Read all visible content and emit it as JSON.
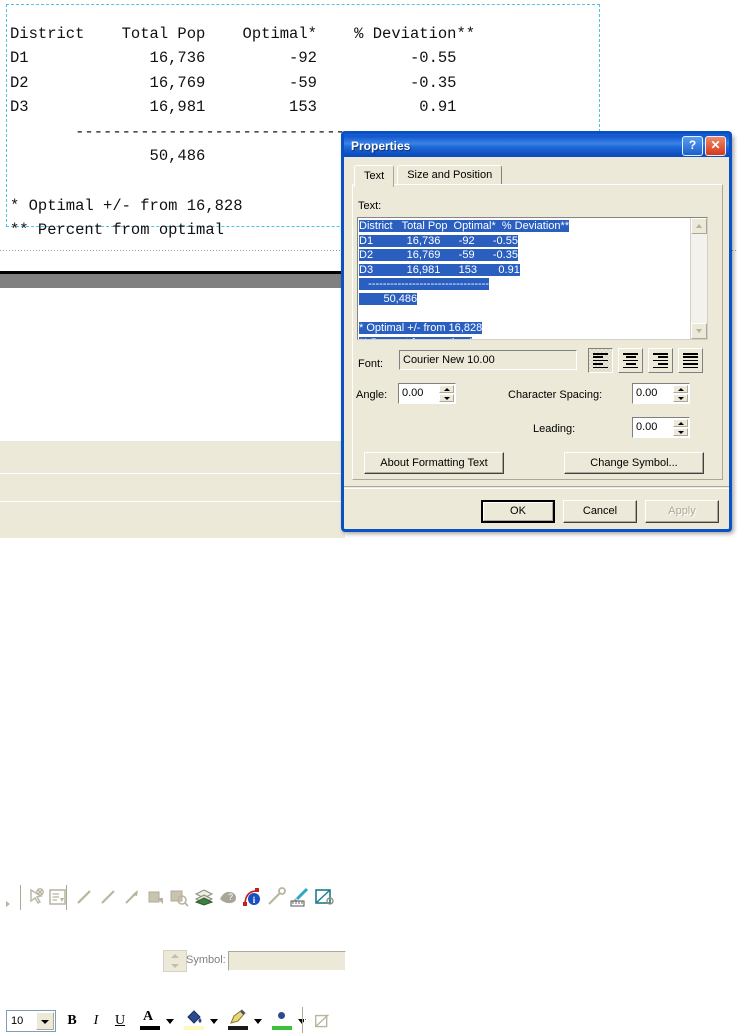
{
  "layout": {
    "report_text": "District    Total Pop    Optimal*    % Deviation**\nD1             16,736         -92          -0.55\nD2             16,769         -59          -0.35\nD3             16,981         153           0.91\n       ------------------------------------------\n               50,486\n\n* Optimal +/- from 16,828\n** Percent from optimal"
  },
  "report_table": {
    "columns": [
      "District",
      "Total Pop",
      "Optimal*",
      "% Deviation**"
    ],
    "rows": [
      [
        "D1",
        "16,736",
        "-92",
        "-0.55"
      ],
      [
        "D2",
        "16,769",
        "-59",
        "-0.35"
      ],
      [
        "D3",
        "16,981",
        "153",
        "0.91"
      ]
    ],
    "total": "50,486",
    "footnotes": [
      "* Optimal +/- from 16,828",
      "** Percent from optimal"
    ]
  },
  "dialog": {
    "title": "Properties",
    "help_button": "?",
    "close_button": "✕",
    "tabs": [
      {
        "label": "Text",
        "active": true
      },
      {
        "label": "Size and Position",
        "active": false
      }
    ],
    "text_label": "Text:",
    "editor": {
      "lines": [
        "District   Total Pop  Optimal*  % Deviation**",
        "D1           16,736      -92      -0.55",
        "D2           16,769      -59      -0.35",
        "D3           16,981      153       0.91",
        "   ---------------------------------",
        "        50,486",
        "",
        "* Optimal +/- from 16,828",
        "** Percent from optimal"
      ],
      "selected": true
    },
    "font_label": "Font:",
    "font_value": "Courier New 10.00",
    "alignment_buttons": [
      {
        "name": "align-left",
        "active": true
      },
      {
        "name": "align-center",
        "active": false
      },
      {
        "name": "align-right",
        "active": false
      },
      {
        "name": "align-justify",
        "active": false
      }
    ],
    "angle_label": "Angle:",
    "angle_value": "0.00",
    "character_spacing_label": "Character Spacing:",
    "character_spacing_value": "0.00",
    "leading_label": "Leading:",
    "leading_value": "0.00",
    "about_formatting_button": "About Formatting Text",
    "change_symbol_button": "Change Symbol...",
    "ok_button": "OK",
    "cancel_button": "Cancel",
    "apply_button": "Apply"
  },
  "toolbars": {
    "symbol_label": "Symbol:",
    "symbol_value": "",
    "font_size": "10",
    "bold_label": "B",
    "italic_label": "I",
    "underline_label": "U",
    "font_color_label": "A",
    "draw_icons": [
      "select-elements-icon",
      "rotate-element-icon",
      "line-icon",
      "line-thin-icon",
      "arrow-icon",
      "fill-icon",
      "zoom-select-icon",
      "layers-icon",
      "identify-shadow-icon",
      "measure-info-icon",
      "lollipop-icon",
      "ruler-pen-icon",
      "snap-icon"
    ]
  },
  "colors": {
    "titlebar_blue": "#0a51c4",
    "dialog_face": "#ece9d8",
    "selection_blue": "#2a5fc0",
    "selection_dash": "#4fc3e8",
    "page_shadow": "#808080"
  }
}
